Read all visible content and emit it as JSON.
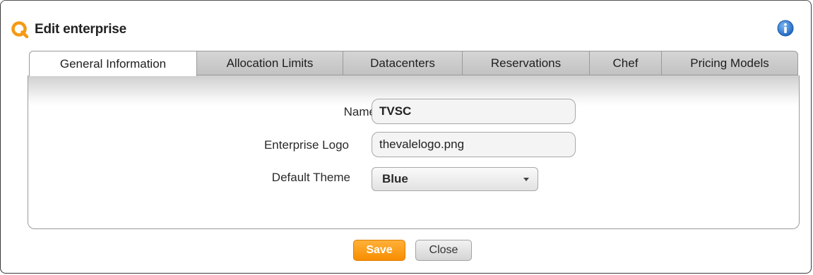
{
  "dialog": {
    "title": "Edit enterprise",
    "app_icon": "abiquo-q-logo",
    "help_icon": "info-icon"
  },
  "tabs": [
    {
      "label": "General Information",
      "active": true
    },
    {
      "label": "Allocation Limits",
      "active": false
    },
    {
      "label": "Datacenters",
      "active": false
    },
    {
      "label": "Reservations",
      "active": false
    },
    {
      "label": "Chef",
      "active": false
    },
    {
      "label": "Pricing Models",
      "active": false
    }
  ],
  "form": {
    "name": {
      "label": "Name",
      "required_marker": "*",
      "value": "TVSC"
    },
    "logo": {
      "label": "Enterprise Logo",
      "value": "thevalelogo.png"
    },
    "theme": {
      "label": "Default Theme",
      "selected": "Blue"
    }
  },
  "buttons": {
    "save": "Save",
    "close": "Close"
  },
  "colors": {
    "accent_orange": "#f79a1c",
    "info_blue": "#2f7fd6",
    "required_red": "#e23b2b"
  }
}
